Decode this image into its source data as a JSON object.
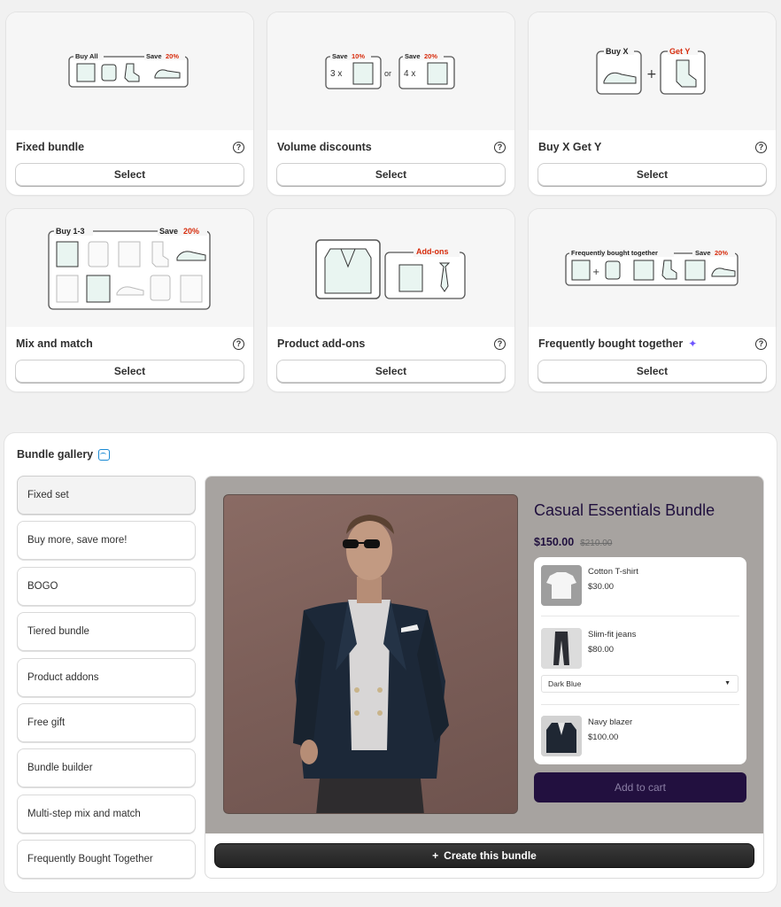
{
  "cards": [
    {
      "title": "Fixed bundle",
      "select_label": "Select",
      "illus": {
        "left_label": "Buy All",
        "right_label": "Save",
        "right_value": "20%"
      }
    },
    {
      "title": "Volume discounts",
      "select_label": "Select",
      "illus": {
        "a_label": "Save",
        "a_value": "10%",
        "a_qty": "3 x",
        "or": "or",
        "b_label": "Save",
        "b_value": "20%",
        "b_qty": "4 x"
      }
    },
    {
      "title": "Buy X Get Y",
      "select_label": "Select",
      "illus": {
        "x_label": "Buy X",
        "y_label": "Get Y"
      }
    },
    {
      "title": "Mix and match",
      "select_label": "Select",
      "illus": {
        "left_label": "Buy 1-3",
        "right_label": "Save",
        "right_value": "20%"
      }
    },
    {
      "title": "Product add-ons",
      "select_label": "Select",
      "illus": {
        "label": "Add-ons"
      }
    },
    {
      "title": "Frequently bought together",
      "select_label": "Select",
      "illus": {
        "left_label": "Frequently bought together",
        "right_label": "Save",
        "right_value": "20%"
      }
    }
  ],
  "gallery": {
    "title": "Bundle gallery",
    "items": [
      "Fixed set",
      "Buy more, save more!",
      "BOGO",
      "Tiered bundle",
      "Product addons",
      "Free gift",
      "Bundle builder",
      "Multi-step mix and match",
      "Frequently Bought Together"
    ],
    "preview": {
      "title": "Casual Essentials Bundle",
      "price": "$150.00",
      "compare_price": "$210.00",
      "products": [
        {
          "name": "Cotton T-shirt",
          "price": "$30.00"
        },
        {
          "name": "Slim-fit jeans",
          "price": "$80.00",
          "variant": "Dark Blue"
        },
        {
          "name": "Navy blazer",
          "price": "$100.00"
        }
      ],
      "add_to_cart": "Add to cart"
    },
    "create_label": "Create this bundle",
    "create_icon": "+"
  },
  "colors": {
    "accent_red": "#d72c0d",
    "dark_purple": "#22103f",
    "sparkle": "#6e55ff"
  }
}
